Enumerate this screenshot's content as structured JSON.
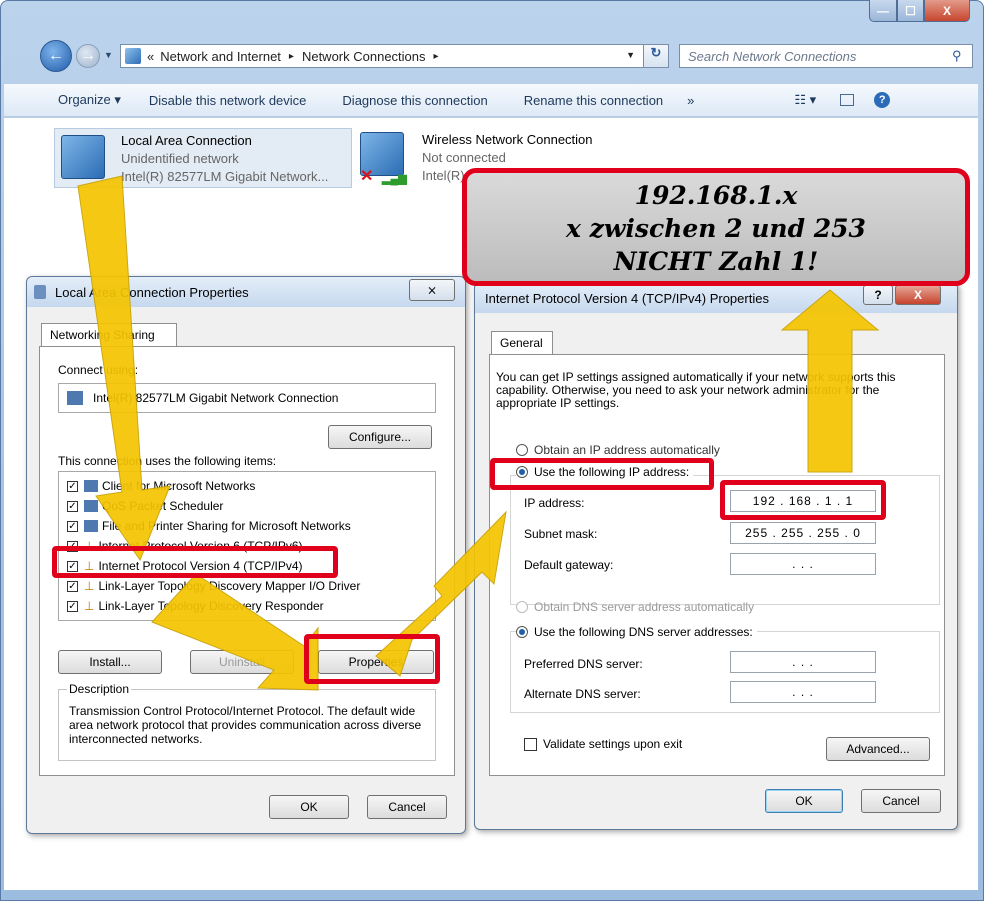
{
  "window": {
    "min": "—",
    "max": "☐",
    "close": "X"
  },
  "nav": {
    "back": "←",
    "forward": "→"
  },
  "address": {
    "parts": [
      "«",
      "Network and Internet",
      "▸",
      "Network Connections",
      "▸"
    ],
    "refresh": "↻"
  },
  "search": {
    "placeholder": "Search Network Connections"
  },
  "toolbar": {
    "organize": "Organize ▾",
    "disable": "Disable this network device",
    "diagnose": "Diagnose this connection",
    "rename": "Rename this connection",
    "more": "»",
    "view": "☷ ▾",
    "help": "?"
  },
  "connections": [
    {
      "name": "Local Area Connection",
      "status": "Unidentified network",
      "adapter": "Intel(R) 82577LM Gigabit Network..."
    },
    {
      "name": "Wireless Network Connection",
      "status": "Not connected",
      "adapter": "Intel(R)"
    }
  ],
  "callout": {
    "line1": "192.168.1.x",
    "line2": "x zwischen 2 und 253",
    "line3": "NICHT Zahl 1!"
  },
  "lac": {
    "title": "Local Area Connection Properties",
    "tab": "Networking Sharing",
    "connect_label": "Connect using:",
    "adapter": "Intel(R) 82577LM Gigabit Network Connection",
    "configure": "Configure...",
    "items_label": "This connection uses the following items:",
    "items": [
      "Client for Microsoft Networks",
      "QoS Packet Scheduler",
      "File and Printer Sharing for Microsoft Networks",
      "Internet Protocol Version 6 (TCP/IPv6)",
      "Internet Protocol Version 4 (TCP/IPv4)",
      "Link-Layer Topology Discovery Mapper I/O Driver",
      "Link-Layer Topology Discovery Responder"
    ],
    "install": "Install...",
    "uninstall": "Uninstall",
    "properties": "Properties",
    "desc_label": "Description",
    "desc": "Transmission Control Protocol/Internet Protocol. The default wide area network protocol that provides communication across diverse interconnected networks.",
    "ok": "OK",
    "cancel": "Cancel"
  },
  "ipv4": {
    "title": "Internet Protocol Version 4 (TCP/IPv4) Properties",
    "tab": "General",
    "intro": "You can get IP settings assigned automatically if your network supports this capability. Otherwise, you need to ask your network administrator for the appropriate IP settings.",
    "auto_ip": "Obtain an IP address automatically",
    "use_ip": "Use the following IP address:",
    "ip_label": "IP address:",
    "ip_value": "192 . 168 . 1 . 1",
    "mask_label": "Subnet mask:",
    "mask_value": "255 . 255 . 255 . 0",
    "gw_label": "Default gateway:",
    "empty_ip": ".      .      .",
    "auto_dns": "Obtain DNS server address automatically",
    "use_dns": "Use the following DNS server addresses:",
    "pref_dns": "Preferred DNS server:",
    "alt_dns": "Alternate DNS server:",
    "validate": "Validate settings upon exit",
    "advanced": "Advanced...",
    "ok": "OK",
    "cancel": "Cancel",
    "help": "?",
    "close": "X"
  }
}
